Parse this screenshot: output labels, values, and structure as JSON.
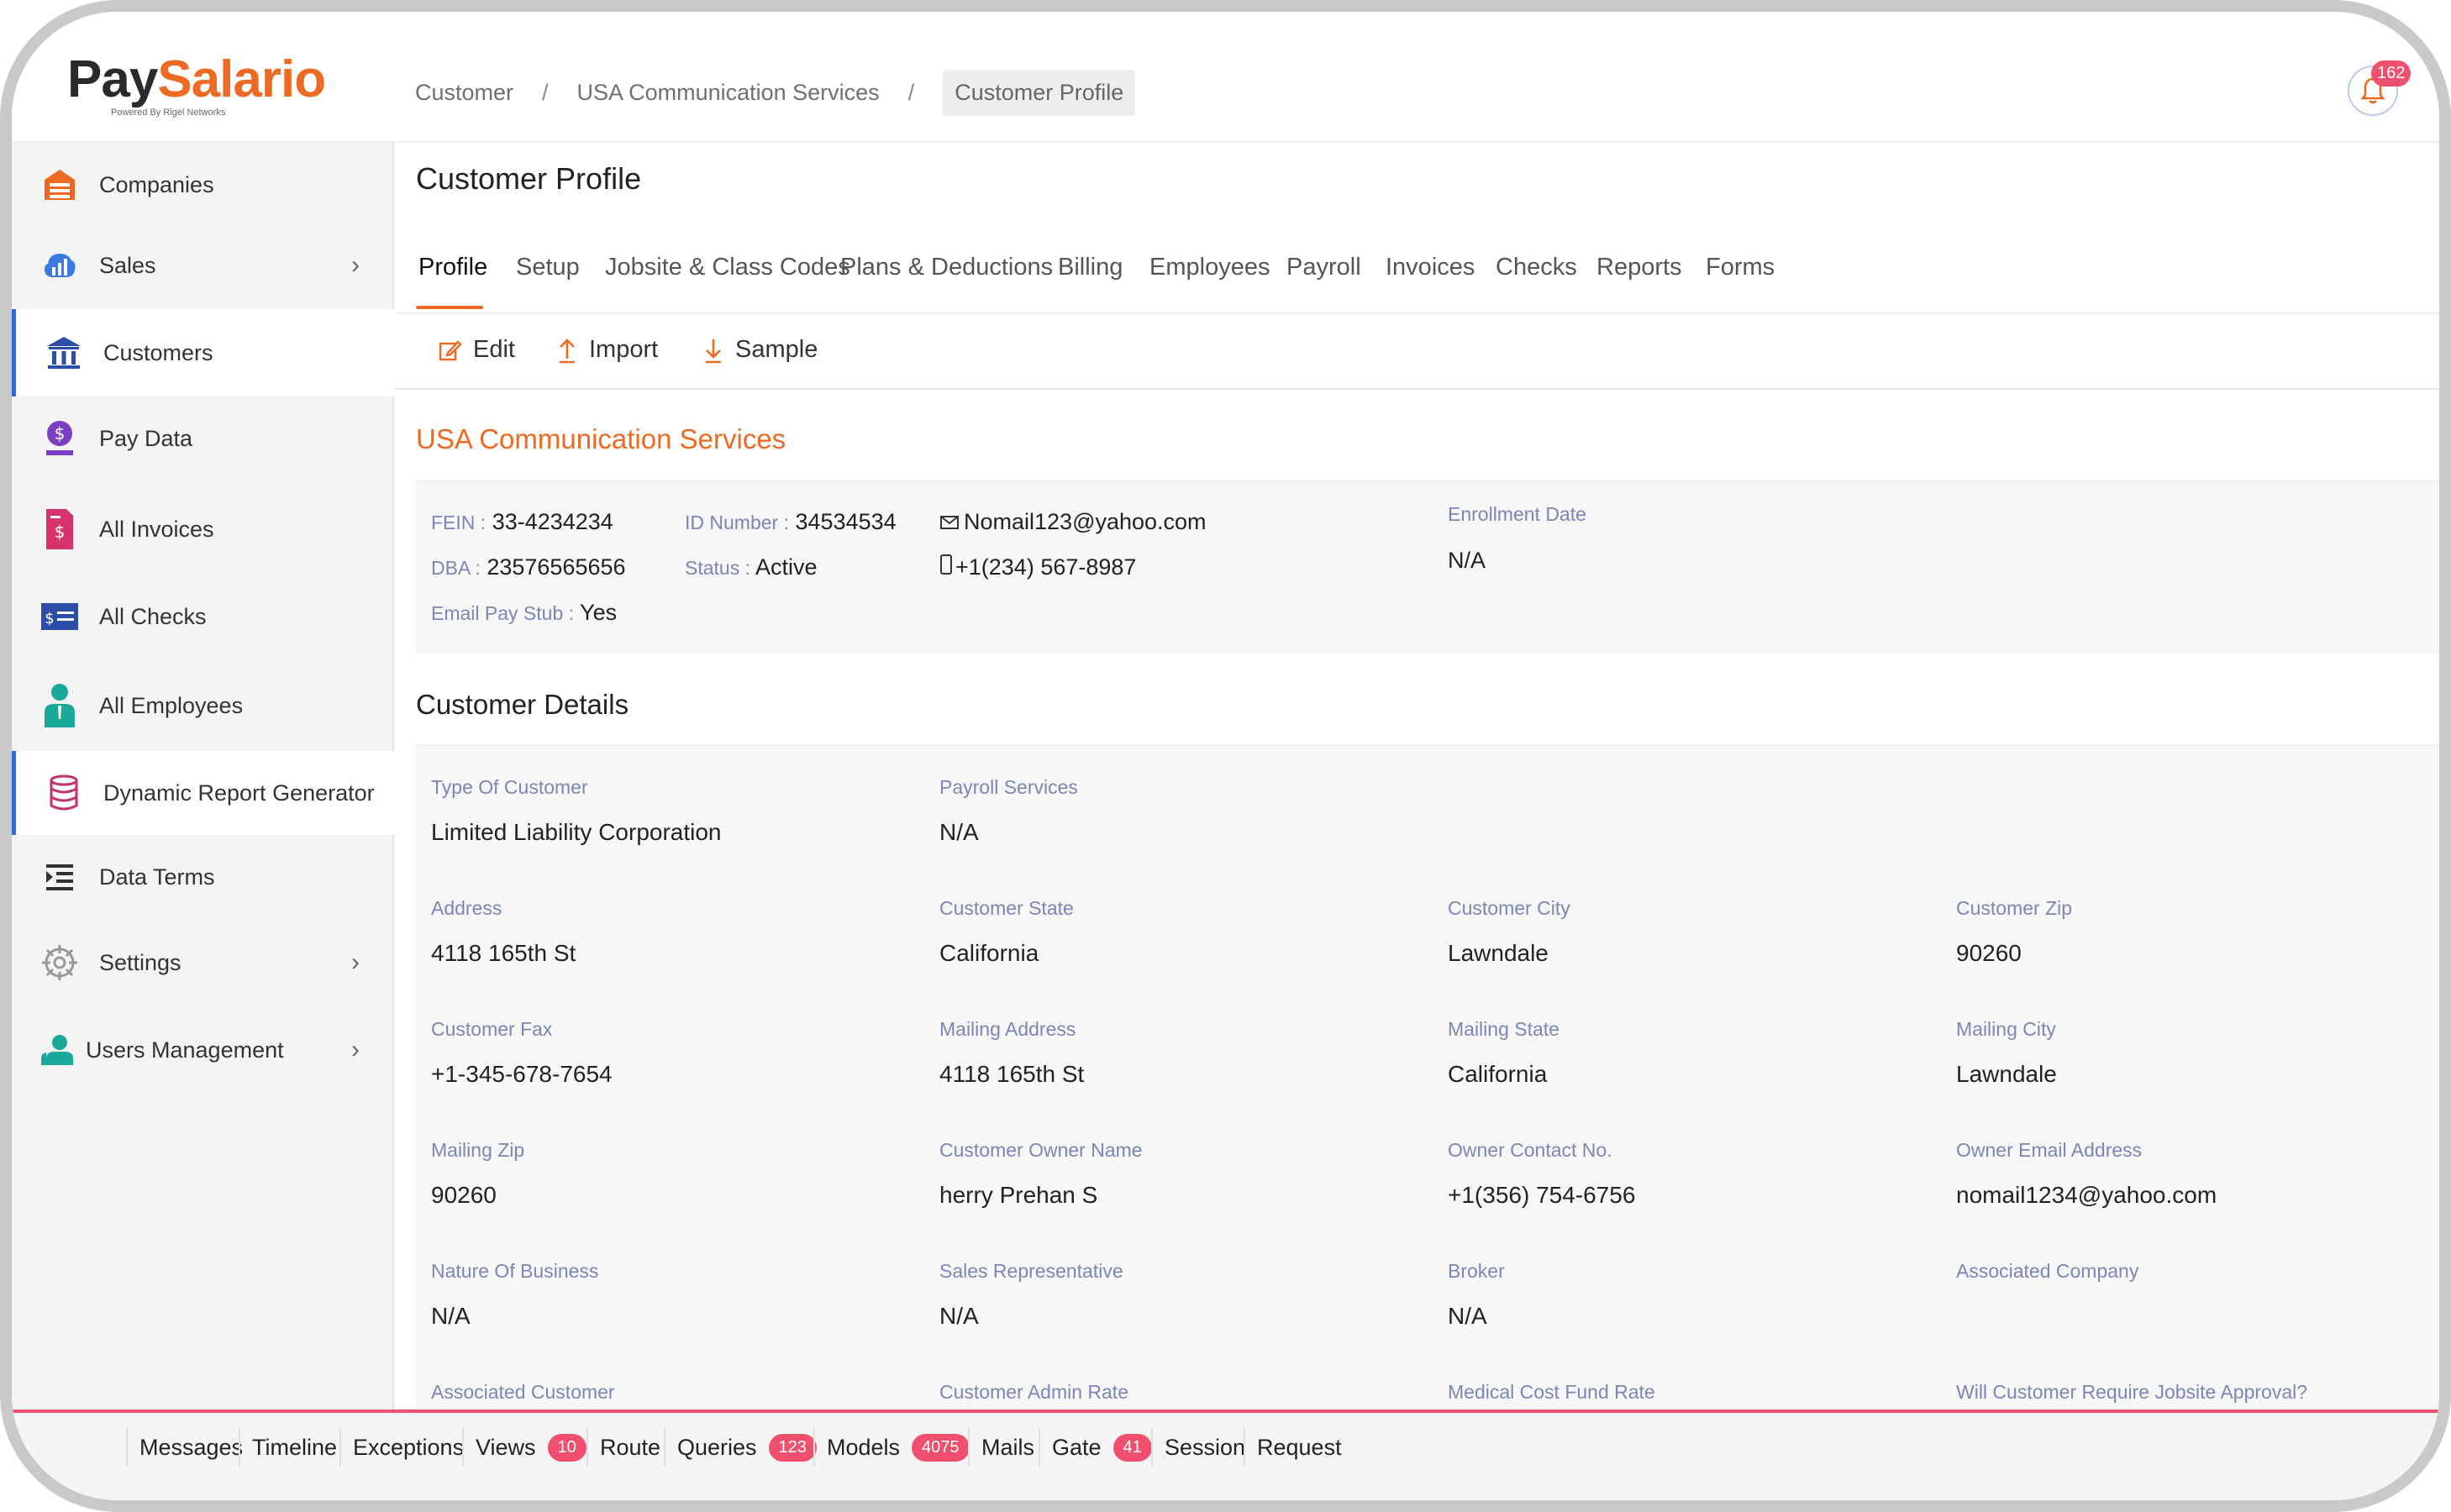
{
  "brand": {
    "logo_part1": "Pay",
    "logo_part2": "Salario",
    "tagline": "Powered By Rigel Networks"
  },
  "breadcrumb": {
    "items": [
      "Customer",
      "USA Communication Services",
      "Customer Profile"
    ],
    "separator": "/"
  },
  "notifications": {
    "count": "162"
  },
  "sidebar": {
    "items": [
      {
        "label": "Companies",
        "icon": "warehouse-icon"
      },
      {
        "label": "Sales",
        "icon": "bar-chart-icon"
      },
      {
        "label": "Customers",
        "icon": "bank-icon"
      },
      {
        "label": "Pay Data",
        "icon": "money-user-icon"
      },
      {
        "label": "All Invoices",
        "icon": "invoice-icon"
      },
      {
        "label": "All Checks",
        "icon": "check-icon"
      },
      {
        "label": "All Employees",
        "icon": "employee-icon"
      },
      {
        "label": "Dynamic Report Generator",
        "icon": "database-icon"
      },
      {
        "label": "Data Terms",
        "icon": "list-icon"
      },
      {
        "label": "Settings",
        "icon": "gear-icon"
      },
      {
        "label": "Users Management",
        "icon": "users-icon"
      }
    ]
  },
  "page": {
    "title": "Customer Profile"
  },
  "tabs": [
    "Profile",
    "Setup",
    "Jobsite & Class Codes",
    "Plans & Deductions",
    "Billing",
    "Employees",
    "Payroll",
    "Invoices",
    "Checks",
    "Reports",
    "Forms"
  ],
  "toolbar": {
    "edit": "Edit",
    "import": "Import",
    "sample": "Sample"
  },
  "company": {
    "name": "USA Communication Services",
    "fein_label": "FEIN :",
    "fein": "33-4234234",
    "dba_label": "DBA :",
    "dba": "23576565656",
    "email_pay_stub_label": "Email Pay Stub :",
    "email_pay_stub": "Yes",
    "id_label": "ID Number :",
    "id_number": "34534534",
    "status_label": "Status :",
    "status": "Active",
    "email": "Nomail123@yahoo.com",
    "phone": "+1(234) 567-8987",
    "enrollment_label": "Enrollment Date",
    "enrollment": "N/A"
  },
  "details": {
    "title": "Customer Details",
    "fields": [
      {
        "label": "Type Of Customer",
        "value": "Limited Liability Corporation"
      },
      {
        "label": "Payroll Services",
        "value": "N/A"
      },
      {
        "label": "Address",
        "value": "4118 165th St"
      },
      {
        "label": "Customer State",
        "value": "California"
      },
      {
        "label": "Customer City",
        "value": "Lawndale"
      },
      {
        "label": "Customer Zip",
        "value": "90260"
      },
      {
        "label": "Customer Fax",
        "value": "+1-345-678-7654"
      },
      {
        "label": "Mailing Address",
        "value": "4118 165th St"
      },
      {
        "label": "Mailing State",
        "value": "California"
      },
      {
        "label": "Mailing City",
        "value": "Lawndale"
      },
      {
        "label": "Mailing Zip",
        "value": "90260"
      },
      {
        "label": "Customer Owner Name",
        "value": "herry Prehan S"
      },
      {
        "label": "Owner Contact No.",
        "value": "+1(356) 754-6756"
      },
      {
        "label": "Owner Email Address",
        "value": "nomail1234@yahoo.com"
      },
      {
        "label": "Nature Of Business",
        "value": "N/A"
      },
      {
        "label": "Sales Representative",
        "value": "N/A"
      },
      {
        "label": "Broker",
        "value": "N/A"
      },
      {
        "label": "Associated Company",
        "value": ""
      },
      {
        "label": "Associated Customer",
        "value": ""
      },
      {
        "label": "Customer Admin Rate",
        "value": ""
      },
      {
        "label": "Medical Cost Fund Rate",
        "value": ""
      },
      {
        "label": "Will Customer Require Jobsite Approval?",
        "value": ""
      }
    ]
  },
  "debugbar": {
    "items": [
      {
        "label": "Messages",
        "count": ""
      },
      {
        "label": "Timeline",
        "count": ""
      },
      {
        "label": "Exceptions",
        "count": ""
      },
      {
        "label": "Views",
        "count": "10"
      },
      {
        "label": "Route",
        "count": ""
      },
      {
        "label": "Queries",
        "count": "123"
      },
      {
        "label": "Models",
        "count": "4075"
      },
      {
        "label": "Mails",
        "count": ""
      },
      {
        "label": "Gate",
        "count": "41"
      },
      {
        "label": "Session",
        "count": ""
      },
      {
        "label": "Request",
        "count": ""
      }
    ]
  },
  "colors": {
    "accent": "#ee6a23",
    "link_blue": "#3569d4",
    "label": "#7b86b8",
    "badge": "#f0506e"
  }
}
